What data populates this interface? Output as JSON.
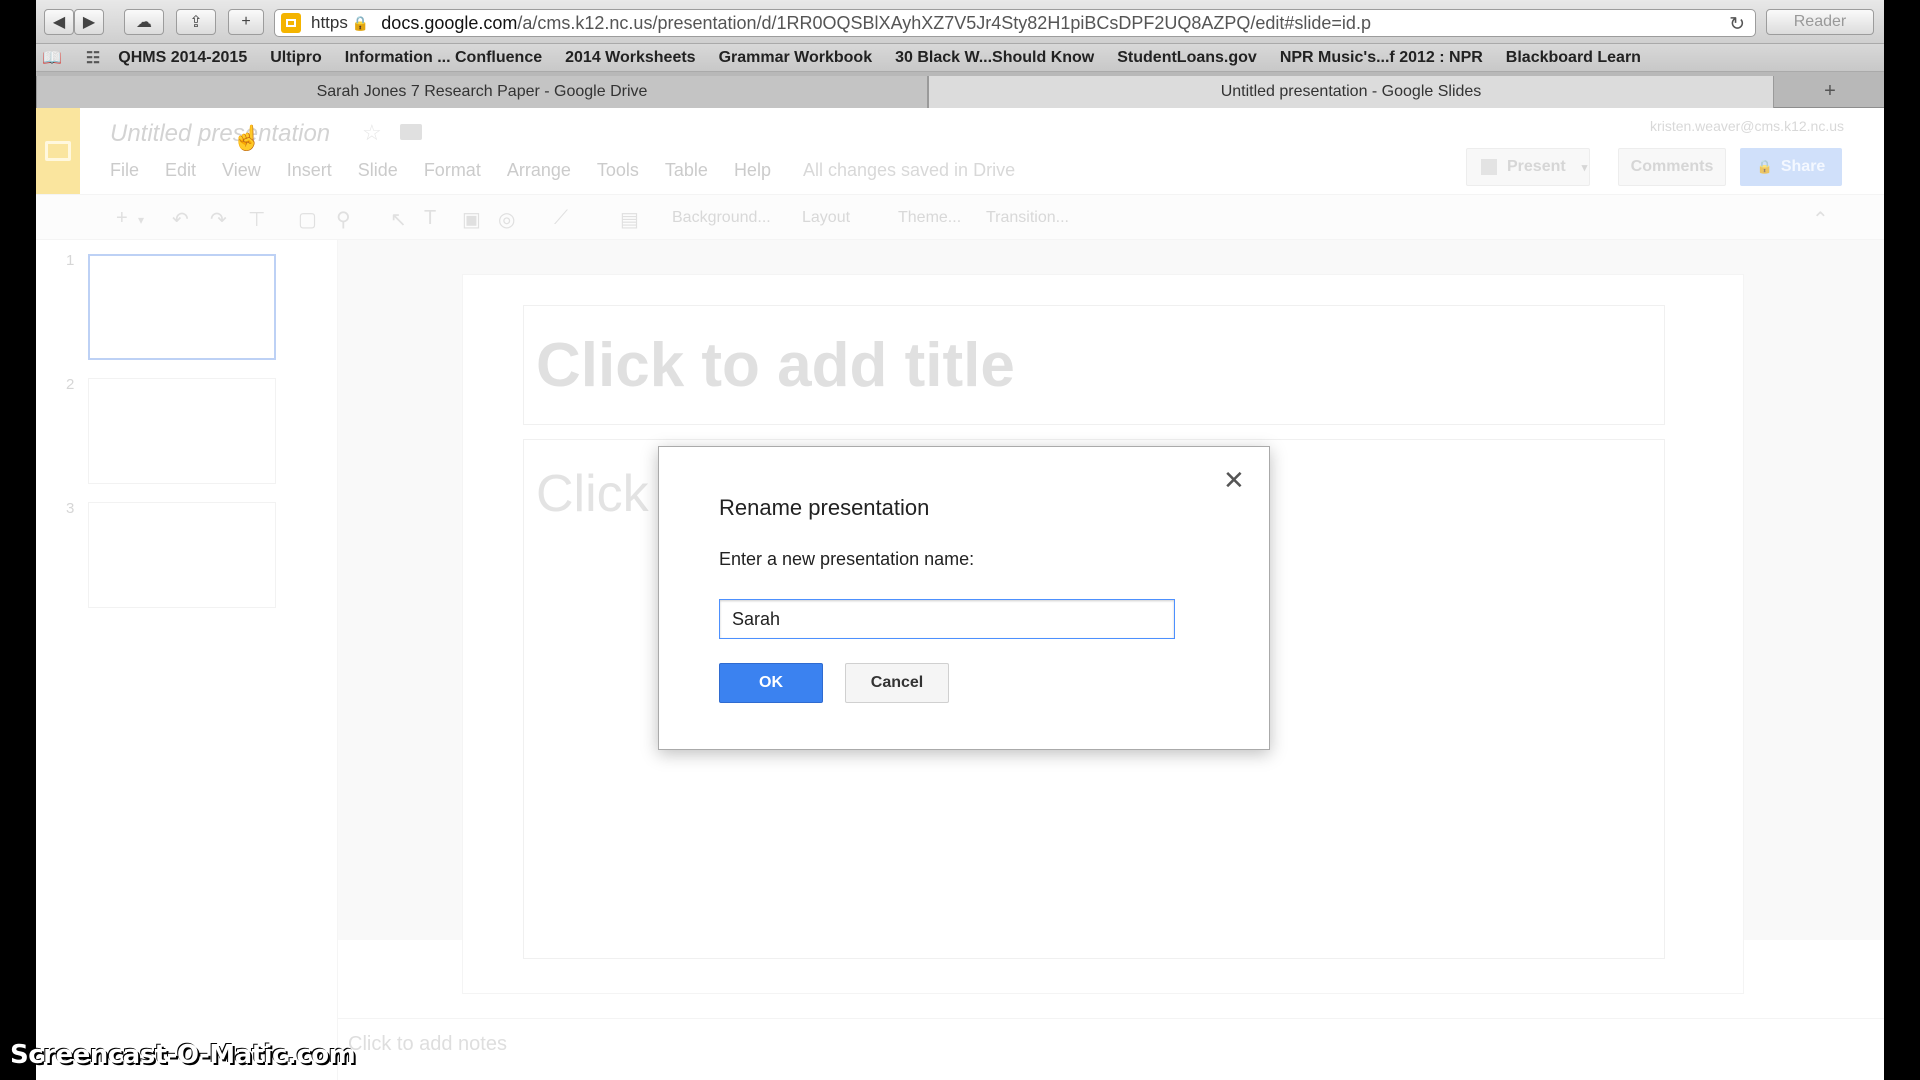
{
  "browser": {
    "url": {
      "scheme": "https",
      "domain": "docs.google.com",
      "path": "/a/cms.k12.nc.us/presentation/d/1RR0OQSBlXAyhXZ7V5Jr4Sty82H1piBCsDPF2UQ8AZPQ/edit#slide=id.p"
    },
    "reader_label": "Reader",
    "bookmarks": [
      "QHMS 2014-2015",
      "Ultipro",
      "Information ... Confluence",
      "2014 Worksheets",
      "Grammar Workbook",
      "30 Black W...Should Know",
      "StudentLoans.gov",
      "NPR Music's...f 2012 : NPR",
      "Blackboard Learn"
    ],
    "tabs": [
      {
        "label": "Sarah Jones 7 Research Paper - Google Drive",
        "active": false
      },
      {
        "label": "Untitled presentation - Google Slides",
        "active": true
      }
    ]
  },
  "app": {
    "doc_title": "Untitled presentation",
    "user_email": "kristen.weaver@cms.k12.nc.us",
    "menu": [
      "File",
      "Edit",
      "View",
      "Insert",
      "Slide",
      "Format",
      "Arrange",
      "Tools",
      "Table",
      "Help"
    ],
    "save_status": "All changes saved in Drive",
    "present_label": "Present",
    "comments_label": "Comments",
    "share_label": "Share",
    "toolbar_text": {
      "background": "Background...",
      "layout": "Layout",
      "theme": "Theme...",
      "transition": "Transition..."
    },
    "slides": [
      {
        "number": "1",
        "selected": true
      },
      {
        "number": "2",
        "selected": false
      },
      {
        "number": "3",
        "selected": false
      }
    ],
    "slide_title_placeholder": "Click to add title",
    "slide_body_placeholder": "Click",
    "notes_placeholder": "Click to add notes"
  },
  "dialog": {
    "title": "Rename presentation",
    "prompt": "Enter a new presentation name:",
    "input_value": "Sarah",
    "ok_label": "OK",
    "cancel_label": "Cancel"
  },
  "watermark": "Screencast-O-Matic.com",
  "colors": {
    "ok_button": "#3b82f0",
    "share_button": "#b7cff7",
    "slides_logo": "#f8d86b"
  }
}
